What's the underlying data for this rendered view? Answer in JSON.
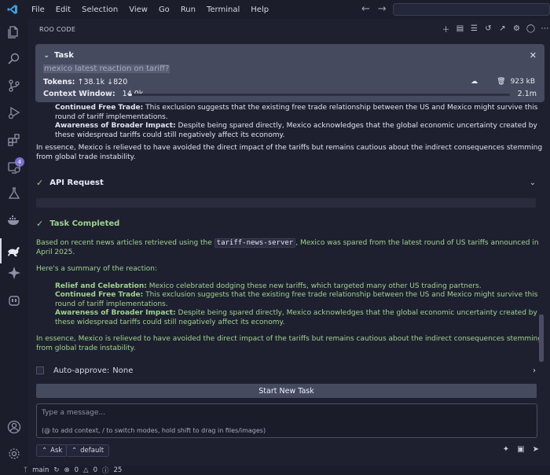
{
  "menu": [
    "File",
    "Edit",
    "Selection",
    "View",
    "Go",
    "Run",
    "Terminal",
    "Help"
  ],
  "activity": {
    "extensions_badge": "4"
  },
  "panel": {
    "title": "ROO CODE"
  },
  "task": {
    "label": "Task",
    "query": "mexico latest reaction on tariff?",
    "tokens_label": "Tokens:",
    "tokens_in": "38.1k",
    "tokens_out": "820",
    "storage": "923 kB",
    "context_label": "Context Window:",
    "context_used": "14.0k",
    "context_max": "2.1m",
    "context_fraction": 0.0067
  },
  "prior": {
    "cft_label": "Continued Free Trade:",
    "cft_text": "This exclusion suggests that the existing free trade relationship between the US and Mexico might survive this round of tariff implementations.",
    "abi_label": "Awareness of Broader Impact:",
    "abi_text": "Despite being spared directly, Mexico acknowledges that the global economic uncertainty created by these widespread tariffs could still negatively affect its economy.",
    "summary": "In essence, Mexico is relieved to have avoided the direct impact of the tariffs but remains cautious about the indirect consequences stemming from global trade instability."
  },
  "api_request": {
    "label": "API Request"
  },
  "completed": {
    "label": "Task Completed",
    "intro_before": "Based on recent news articles retrieved using the",
    "server": "tariff-news-server",
    "intro_after": ", Mexico was spared from the latest round of US tariffs announced in April 2025.",
    "summary_intro": "Here's a summary of the reaction:",
    "rc_label": "Relief and Celebration:",
    "rc_text": "Mexico celebrated dodging these new tariffs, which targeted many other US trading partners.",
    "cft_label": "Continued Free Trade:",
    "cft_text": "This exclusion suggests that the existing free trade relationship between the US and Mexico might survive this round of tariff implementations.",
    "abi_label": "Awareness of Broader Impact:",
    "abi_text": "Despite being spared directly, Mexico acknowledges that the global economic uncertainty created by these widespread tariffs could still negatively affect its economy.",
    "conclusion": "In essence, Mexico is relieved to have avoided the direct impact of the tariffs but remains cautious about the indirect consequences stemming from global trade instability."
  },
  "auto_approve": {
    "label": "Auto-approve:",
    "value": "None"
  },
  "new_task_label": "Start New Task",
  "message": {
    "placeholder": "Type a message...",
    "help": "(@ to add context, / to switch modes, hold shift to drag in files/images)"
  },
  "mode": {
    "ask": "Ask",
    "default": "default"
  },
  "status": {
    "branch": "main",
    "errors": "0",
    "warnings": "0",
    "other": "25"
  }
}
